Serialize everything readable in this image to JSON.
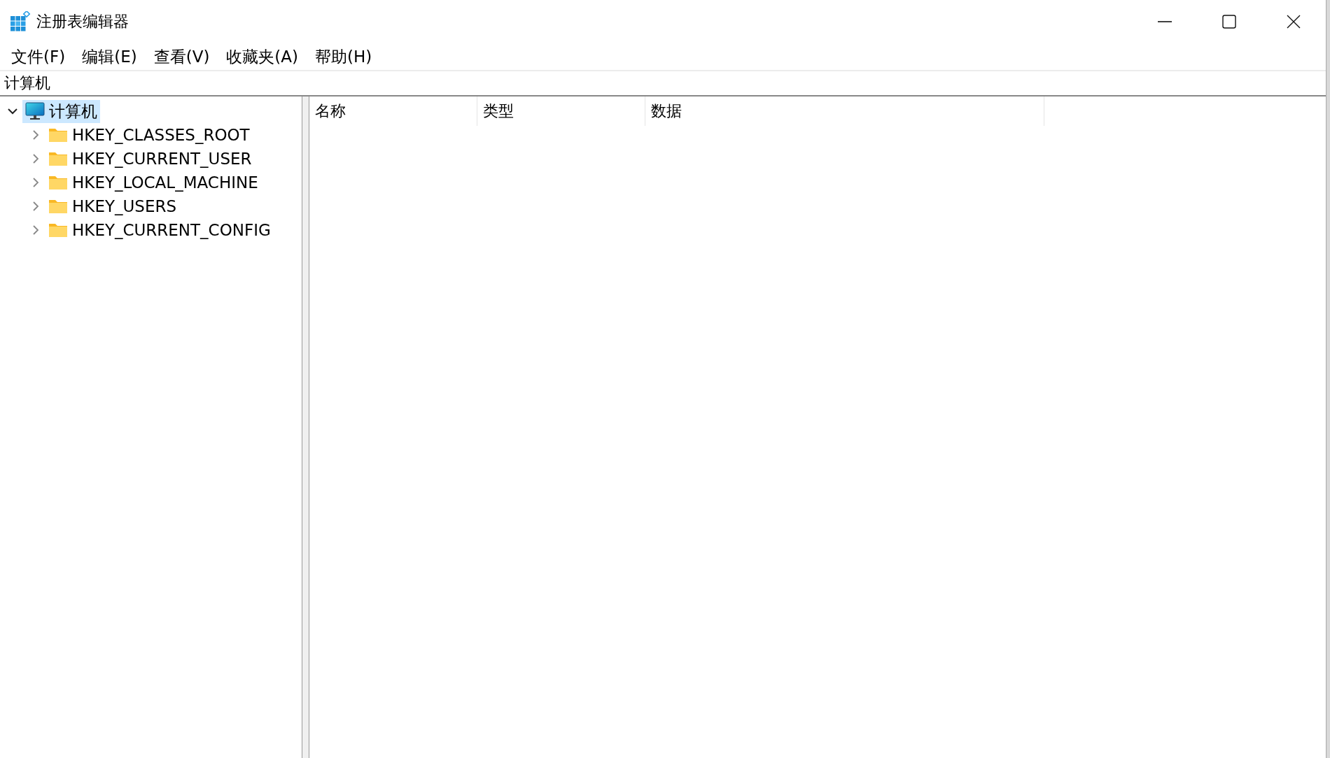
{
  "window": {
    "title": "注册表编辑器"
  },
  "menu": [
    "文件(F)",
    "编辑(E)",
    "查看(V)",
    "收藏夹(A)",
    "帮助(H)"
  ],
  "address_bar": {
    "value": "计算机"
  },
  "tree": [
    {
      "label": "计算机",
      "kind": "computer",
      "selected": true,
      "expanded": true,
      "children": [
        {
          "label": "HKEY_CLASSES_ROOT",
          "kind": "folder",
          "selected": false,
          "expanded": false
        },
        {
          "label": "HKEY_CURRENT_USER",
          "kind": "folder",
          "selected": false,
          "expanded": false
        },
        {
          "label": "HKEY_LOCAL_MACHINE",
          "kind": "folder",
          "selected": false,
          "expanded": false
        },
        {
          "label": "HKEY_USERS",
          "kind": "folder",
          "selected": false,
          "expanded": false
        },
        {
          "label": "HKEY_CURRENT_CONFIG",
          "kind": "folder",
          "selected": false,
          "expanded": false
        }
      ]
    }
  ],
  "table": {
    "columns": [
      "名称",
      "类型",
      "数据"
    ]
  }
}
